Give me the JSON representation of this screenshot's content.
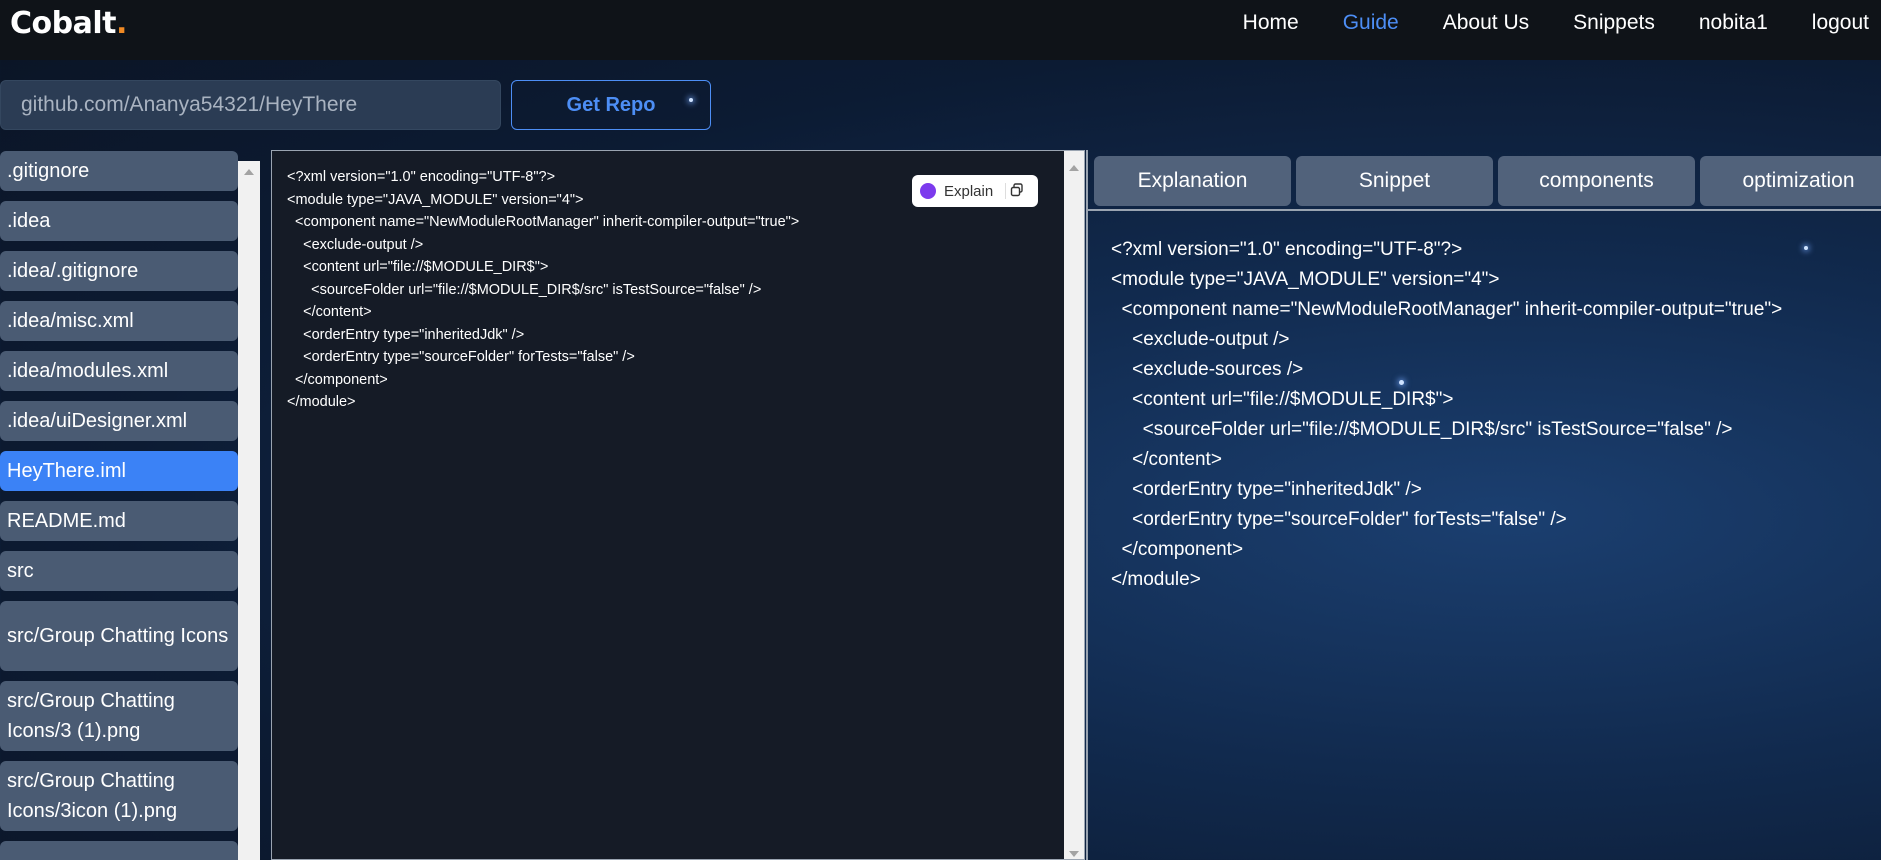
{
  "navbar": {
    "brand": "Cobalt",
    "brand_dot": ".",
    "links": [
      "Home",
      "Guide",
      "About Us",
      "Snippets",
      "nobita1",
      "logout"
    ],
    "active_link": "Guide"
  },
  "repo": {
    "input_value": "github.com/Ananya54321/HeyThere",
    "button_label": "Get Repo"
  },
  "sidebar": {
    "items": [
      ".gitignore",
      ".idea",
      ".idea/.gitignore",
      ".idea/misc.xml",
      ".idea/modules.xml",
      ".idea/uiDesigner.xml",
      "HeyThere.iml",
      "README.md",
      "src",
      "src/Group Chatting Icons",
      "src/Group Chatting Icons/3 (1).png",
      "src/Group Chatting Icons/3icon (1).png"
    ],
    "active_item": "HeyThere.iml"
  },
  "code": {
    "content": "<?xml version=\"1.0\" encoding=\"UTF-8\"?>\n<module type=\"JAVA_MODULE\" version=\"4\">\n  <component name=\"NewModuleRootManager\" inherit-compiler-output=\"true\">\n    <exclude-output />\n    <content url=\"file://$MODULE_DIR$\">\n      <sourceFolder url=\"file://$MODULE_DIR$/src\" isTestSource=\"false\" />\n    </content>\n    <orderEntry type=\"inheritedJdk\" />\n    <orderEntry type=\"sourceFolder\" forTests=\"false\" />\n  </component>\n</module>",
    "explain_label": "Explain",
    "explain_icon": "brain-icon",
    "copy_icon": "copy-icon"
  },
  "tabs": [
    "Explanation",
    "Snippet",
    "components",
    "optimization"
  ],
  "explanation": {
    "content": "<?xml version=\"1.0\" encoding=\"UTF-8\"?>\n<module type=\"JAVA_MODULE\" version=\"4\">\n  <component name=\"NewModuleRootManager\" inherit-compiler-output=\"true\">\n    <exclude-output />\n    <exclude-sources />\n    <content url=\"file://$MODULE_DIR$\">\n      <sourceFolder url=\"file://$MODULE_DIR$/src\" isTestSource=\"false\" />\n    </content>\n    <orderEntry type=\"inheritedJdk\" />\n    <orderEntry type=\"sourceFolder\" forTests=\"false\" />\n  </component>\n</module>"
  },
  "colors": {
    "accent": "#4d8ef5",
    "brand_dot": "#f08a24",
    "active_item": "#3b82f6",
    "sidebar_item": "#4a5b73",
    "tab": "#51627b",
    "navbar": "#0f1318",
    "code_bg": "#151b26"
  }
}
